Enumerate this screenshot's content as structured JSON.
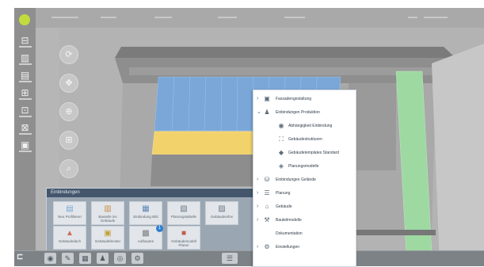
{
  "panel": {
    "header": "Einbindungen",
    "tiles": [
      {
        "label": "Neu Profilieren",
        "icon": "folder-icon",
        "glyph": "▤"
      },
      {
        "label": "Bauteile ins Gebäude",
        "icon": "building-icon",
        "glyph": "▥"
      },
      {
        "label": "Einbindung Bild",
        "icon": "image-icon",
        "glyph": "▦"
      },
      {
        "label": "Planungstabelle",
        "icon": "table-icon",
        "glyph": "▧"
      },
      {
        "label": "Gebäudeinfos",
        "icon": "sheet-icon",
        "glyph": "▨"
      },
      {
        "label": "Gebäudedach",
        "icon": "roof-icon",
        "glyph": "▲"
      },
      {
        "label": "Gebäudefenster",
        "icon": "window-icon",
        "glyph": "▣"
      },
      {
        "label": "Aufbauten",
        "icon": "layers-icon",
        "glyph": "▩"
      },
      {
        "label": "Gebäudemodell Planer",
        "icon": "model-icon",
        "glyph": "■"
      }
    ],
    "badge": "1"
  },
  "menu": {
    "items": [
      {
        "label": "Fassadengestaltung",
        "level": 0,
        "icon": "folder-icon",
        "glyph": "▣",
        "chev": "›"
      },
      {
        "label": "Einbindungen Produktion",
        "level": 0,
        "icon": "person-icon",
        "glyph": "♟",
        "chev": "⌄"
      },
      {
        "label": "Abhängigkeit Einbindung",
        "level": 1,
        "icon": "globe-icon",
        "glyph": "◉"
      },
      {
        "label": "Gebäudestrukturen",
        "level": 1,
        "icon": "network-icon",
        "glyph": "⛶"
      },
      {
        "label": "Gebäudetemplates Standard",
        "level": 1,
        "icon": "shield-icon",
        "glyph": "◆"
      },
      {
        "label": "Planungsmodelle",
        "level": 1,
        "icon": "tag-icon",
        "glyph": "◈"
      },
      {
        "label": "Einbindungen Gelände",
        "level": 0,
        "icon": "cylinder-icon",
        "glyph": "⛁",
        "chev": "›"
      },
      {
        "label": "Planung",
        "level": 0,
        "icon": "stack-icon",
        "glyph": "☰",
        "chev": "›"
      },
      {
        "label": "Gebäude",
        "level": 0,
        "icon": "house-icon",
        "glyph": "⌂",
        "chev": "›"
      },
      {
        "label": "Bauteilmodelle",
        "level": 0,
        "icon": "wrench-icon",
        "glyph": "⚒",
        "chev": "›"
      },
      {
        "label": "Dokumentation",
        "level": 0,
        "icon": "",
        "glyph": "",
        "chev": ""
      },
      {
        "label": "Einstellungen",
        "level": 0,
        "icon": "settings-icon",
        "glyph": "⚙",
        "chev": "›"
      }
    ]
  },
  "colors": {
    "roof_blue": "#7aa7d8",
    "roof_yellow": "#f2d36b",
    "roof_green": "#9ed9a2",
    "panel_header": "#44566c",
    "logo": "#c2dc3d"
  }
}
